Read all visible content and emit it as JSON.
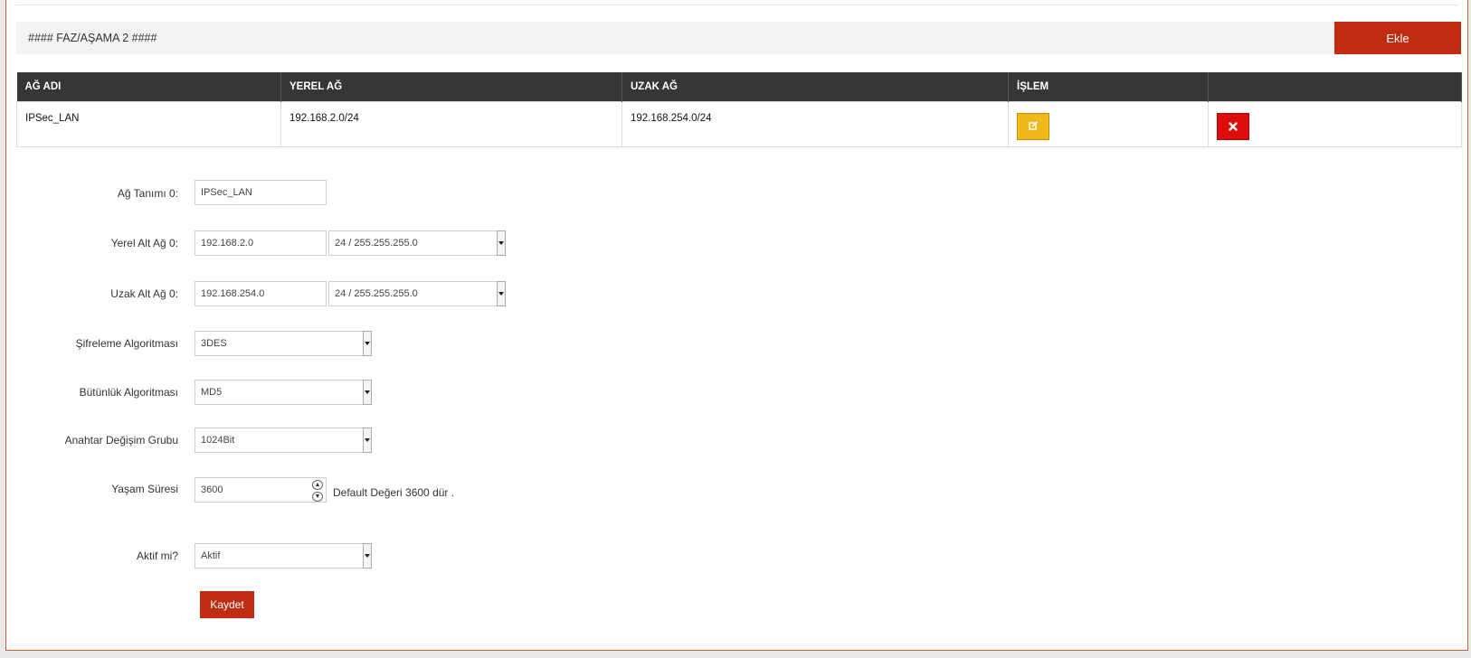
{
  "phase": {
    "title": "#### FAZ/AŞAMA 2 ####",
    "add_label": "Ekle"
  },
  "table": {
    "headers": [
      "AĞ ADI",
      "YEREL AĞ",
      "UZAK AĞ",
      "İŞLEM"
    ],
    "rows": [
      {
        "name": "IPSec_LAN",
        "local": "192.168.2.0/24",
        "remote": "192.168.254.0/24"
      }
    ],
    "edit_color": "#efb81b",
    "delete_color": "#dd0d0d"
  },
  "form": {
    "network_label": "Ağ Tanımı 0:",
    "network_value": "IPSec_LAN",
    "local_label": "Yerel Alt Ağ 0:",
    "local_ip": "192.168.2.0",
    "local_mask": "24 / 255.255.255.0",
    "remote_label": "Uzak Alt Ağ 0:",
    "remote_ip": "192.168.254.0",
    "remote_mask": "24 / 255.255.255.0",
    "encryption_label": "Şifreleme Algoritması",
    "encryption_value": "3DES",
    "integrity_label": "Bütünlük Algoritması",
    "integrity_value": "MD5",
    "dh_label": "Anahtar Değişim Grubu",
    "dh_value": "1024Bit",
    "lifetime_label": "Yaşam Süresi",
    "lifetime_value": "3600",
    "lifetime_hint": "Default Değeri 3600 dür .",
    "active_label": "Aktif mi?",
    "active_value": "Aktif",
    "save_label": "Kaydet"
  },
  "colors": {
    "accent": "#bf2c12",
    "header_bg": "#363636"
  }
}
